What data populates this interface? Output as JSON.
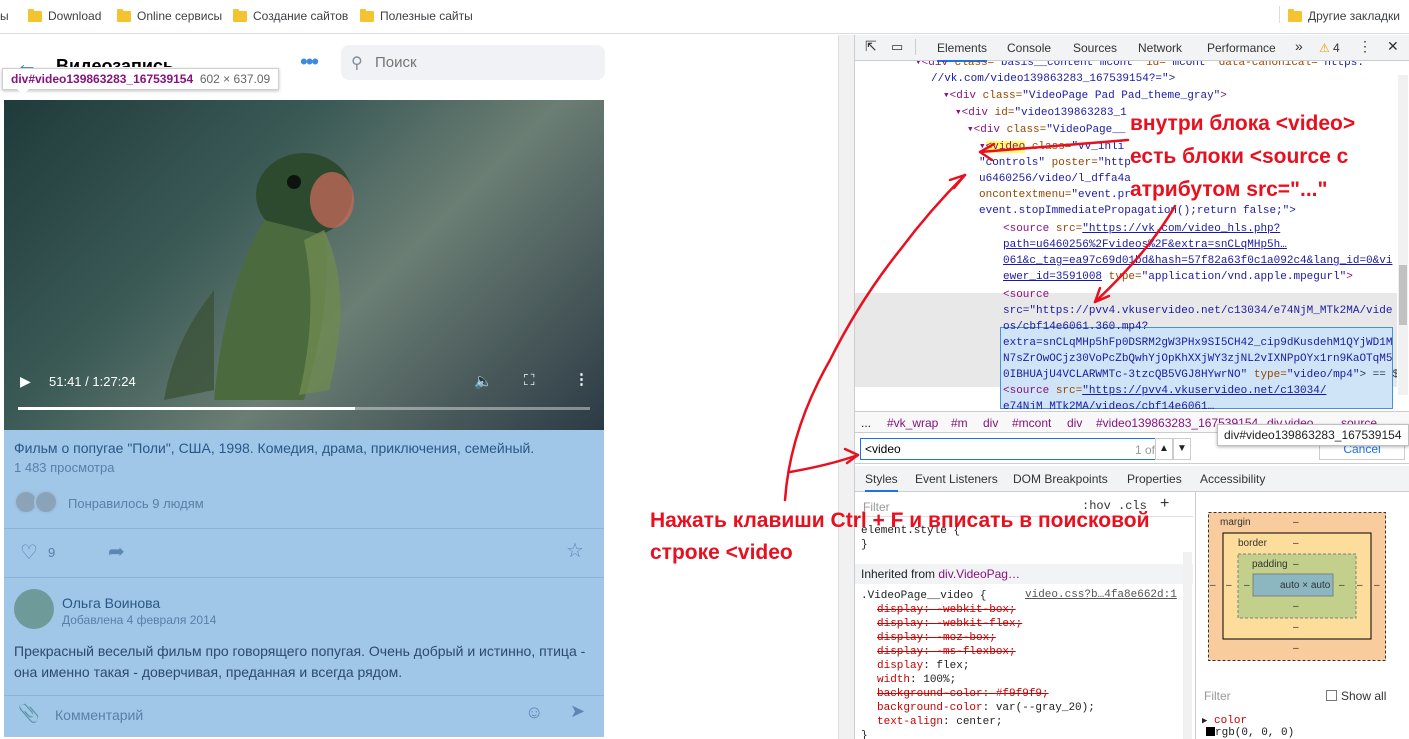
{
  "bookmarks": {
    "items": [
      {
        "label": "ы"
      },
      {
        "label": "Download"
      },
      {
        "label": "Online сервисы"
      },
      {
        "label": "Создание сайтов"
      },
      {
        "label": "Полезные сайты"
      }
    ],
    "other": "Другие закладки"
  },
  "vk": {
    "title": "Видеозапись",
    "search_placeholder": "Поиск",
    "tooltip_selector": "div#video139863283_167539154",
    "tooltip_size": "602 × 637.09",
    "player": {
      "time": "51:41 / 1:27:24",
      "progress": 0.59
    },
    "description": "Фильм о попугае \"Поли\", США, 1998. Комедия, драма, приключения, семейный.",
    "views": "1 483 просмотра",
    "liked": "Понравилось 9 людям",
    "like_count": "9",
    "comment": {
      "author": "Ольга Воинова",
      "date": "Добавлена 4 февраля 2014",
      "text": "Прекрасный веселый фильм про говорящего попугая. Очень добрый и истинно, птица - она именно такая - доверчивая, преданная и всегда рядом."
    },
    "comment_placeholder": "Комментарий"
  },
  "devtools": {
    "tabs": [
      "Elements",
      "Console",
      "Sources",
      "Network",
      "Performance"
    ],
    "more": "»",
    "warnings": "4",
    "tree": {
      "l1": {
        "tag": "<div ",
        "a1": "class=",
        "v1": "\"basis__content mcont\"",
        "a2": " id=",
        "v2": "\"mcont\"",
        "a3": " data-canonical=",
        "v3": "\"https:"
      },
      "l2": "//vk.com/video139863283_167539154?=\">",
      "l3": {
        "tag": "<div ",
        "a": "class=",
        "v": "\"VideoPage Pad Pad_theme_gray\"",
        "end": ">"
      },
      "l4": {
        "tag": "<div ",
        "a": "id=",
        "v": "\"video139863283_1"
      },
      "l5": {
        "tag": "<div ",
        "a": "class=",
        "v": "\"VideoPage__"
      },
      "l6": {
        "tag": "<video",
        "a": " class=",
        "v": "\"vv_inli"
      },
      "l7": {
        "a": "\"controls\"",
        "b": " poster=",
        "v": "\"http"
      },
      "l8": "u6460256/video/l_dffa4a",
      "l9": {
        "a": "oncontextmenu=",
        "v": "\"event.pr"
      },
      "l10": "event.stopImmediatePropagation();return false;\">",
      "s1a": {
        "tag": "<source ",
        "a": "src=",
        "u": "\"https://vk.com/video_hls.php?"
      },
      "s1b": "path=u6460256%2Fvideos%2F&extra=snCLqMHp5h…",
      "s1c": "061&c_tag=ea97c69d01bd&hash=57f82a63f0c1a092c4&lang_id=0&vi",
      "s1d": {
        "u": "ewer_id=3591008",
        "a": " type=",
        "v": "\"application/vnd.apple.mpegurl\"",
        "end": ">"
      },
      "s2a": "<source",
      "s2b": "src=\"https://pvv4.vkuservideo.net/c13034/e74NjM_MTk2MA/vide",
      "s2c": "os/cbf14e6061.360.mp4?",
      "s2d": "extra=snCLqMHp5hFp0DSRM2gW3PHx9SI5CH42_cip9dKusdehM1QYjWD1M",
      "s2e": "N7sZrOwOCjz30VoPcZbQwhYjOpKhXXjWY3zjNL2vIXNPpOYx1rn9KaOTqM5",
      "s2f": "0IBHUAjU4VCLARWMTc-3tzcQB5VGJ8HYwrNO\"",
      "s2g": {
        "a": " type=",
        "v": "\"video/mp4\"",
        "end": "> == $"
      },
      "s3a": {
        "tag": "<source ",
        "a": "src=",
        "u": "\"https://pvv4.vkuservideo.net/c13034/"
      },
      "s3b": "e74NjM_MTk2MA/videos/cbf14e6061…"
    },
    "breadcrumbs": [
      "...",
      "#vk_wrap",
      "#m",
      "div",
      "#mcont",
      "div",
      "#video139863283_167539154",
      "div.video",
      "source"
    ],
    "crumb_tip": "div#video139863283_167539154",
    "find": {
      "value": "<video",
      "count": "1 of 1",
      "cancel": "Cancel"
    },
    "style_tabs": [
      "Styles",
      "Event Listeners",
      "DOM Breakpoints",
      "Properties",
      "Accessibility"
    ],
    "styles": {
      "filter": "Filter",
      "hov": ":hov  .cls",
      "element_style": "element.style {",
      "close": "}",
      "inherited_label": "Inherited from ",
      "inherited_sel": "div.VideoPag…",
      "rule_sel": ".VideoPage__video {",
      "rule_src": "video.css?b…4fa8e662d:1",
      "props": [
        {
          "n": "display",
          "v": "-webkit-box;",
          "s": true
        },
        {
          "n": "display",
          "v": "-webkit-flex;",
          "s": true
        },
        {
          "n": "display",
          "v": "-moz-box;",
          "s": true
        },
        {
          "n": "display",
          "v": "-ms-flexbox;",
          "s": true
        },
        {
          "n": "display",
          "v": "flex;",
          "s": false
        },
        {
          "n": "width",
          "v": "100%;",
          "s": false
        },
        {
          "n": "background-color",
          "v": "#f9f9f9;",
          "s": true
        },
        {
          "n": "background-color",
          "v": "var(--gray_20);",
          "s": false
        },
        {
          "n": "text-align",
          "v": "center;",
          "s": false
        }
      ]
    },
    "boxmodel": {
      "margin": "margin",
      "border": "border",
      "padding": "padding",
      "content": "auto × auto",
      "dash": "–"
    },
    "computed": {
      "filter": "Filter",
      "show_all": "Show all",
      "prop": "color",
      "val": "rgb(0, 0, 0)"
    }
  },
  "annotations": {
    "a1": "внутри блока <video>",
    "a2": "есть блоки <source с",
    "a3": "атрибутом src=\"...\"",
    "b1": "Нажать клавиши Ctrl + F и вписать в поисковой",
    "b2": "строке <video"
  },
  "colors": {
    "annotation": "#e8101e",
    "vk_accent": "#3f8ae0",
    "highlight": "#6fa8dc"
  }
}
